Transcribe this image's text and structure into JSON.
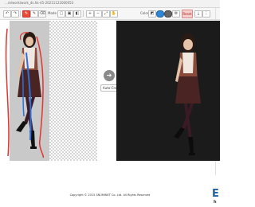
{
  "browser": {
    "url": "…/e/work/work_ds.hk-45-20211122000053"
  },
  "toolbar": {
    "mode_label": "Mode",
    "color_label": "Color",
    "reset_label": "Reset"
  },
  "main": {
    "arrow_symbol": "➔",
    "auto_crop_label": "Auto-Crop"
  },
  "footer": {
    "copyright": "Copyright © 2015 SNUMINET Co. Ltd. All Rights Reserved",
    "brand_letter": "E",
    "brand_sub": "h"
  },
  "colors": {
    "foreground_mark": "#2f6fdc",
    "background_mark": "#e3342f",
    "result_background": "#1b1b1b"
  }
}
